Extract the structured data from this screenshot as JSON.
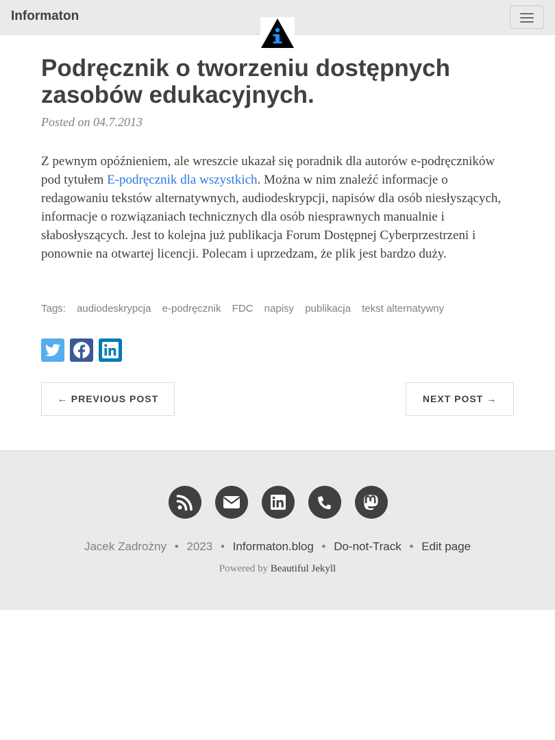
{
  "navbar": {
    "brand": "Informaton",
    "logo_icon": "info-logo-icon",
    "menu_icon": "hamburger-menu-icon"
  },
  "post": {
    "title": "Podręcznik o tworzeniu dostępnych zasobów edukacyjnych.",
    "meta": "Posted on 04.7.2013",
    "body_before_link": "Z pewnym opóźnieniem, ale wreszcie ukazał się poradnik dla autorów e-podręczników pod tytułem ",
    "body_link": "E-podręcznik dla wszystkich",
    "body_after_link": ". Można w nim znaleźć informacje o redagowaniu tekstów alternatywnych, audiodeskrypcji, napisów dla osób niesłyszących, informacje o rozwiązaniach technicznych dla osób niesprawnych manualnie i słabosłyszących. Jest to kolejna już publikacja Forum Dostępnej Cyberprzestrzeni i ponownie na otwartej licencji. Polecam i uprzedzam, że plik jest bardzo duży."
  },
  "tags": {
    "label": "Tags:",
    "items": [
      "audiodeskrypcja",
      "e-podręcznik",
      "FDC",
      "napisy",
      "publikacja",
      "tekst alternatywny"
    ]
  },
  "share": {
    "icons": [
      "twitter-icon",
      "facebook-icon",
      "linkedin-icon"
    ],
    "colors": {
      "twitter": "#55acee",
      "facebook": "#3b5998",
      "linkedin": "#007bb5"
    }
  },
  "pager": {
    "previous": "← PREVIOUS POST",
    "next": "NEXT POST →"
  },
  "footer": {
    "icons": [
      "rss-icon",
      "email-icon",
      "linkedin-icon",
      "phone-icon",
      "mastodon-icon"
    ],
    "author": "Jacek Zadrożny",
    "year": "2023",
    "site": "Informaton.blog",
    "dnt": "Do-not-Track",
    "edit": "Edit page",
    "powered_prefix": "Powered by",
    "powered_link": "Beautiful Jekyll"
  },
  "colors": {
    "text": "#404040",
    "muted": "#808080",
    "link": "#2a7ae2",
    "navbar_bg": "#eaeaea",
    "footer_bg": "#eaeaea"
  }
}
